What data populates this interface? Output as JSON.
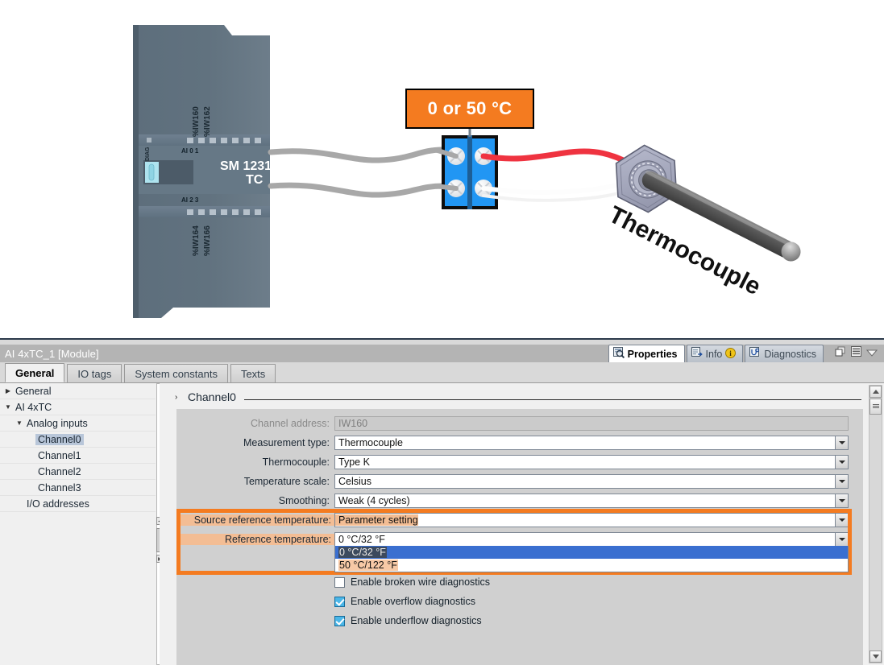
{
  "diagram": {
    "callout_text": "0 or 50 °C",
    "module": {
      "name": "SM 1231",
      "subtitle": "TC",
      "diag_label": "DIAG",
      "addr_top_1": "%IW160",
      "addr_top_2": "%IW162",
      "addr_bot_1": "%IW164",
      "addr_bot_2": "%IW166",
      "ai_top": "AI 0  1",
      "ai_bot": "AI 2  3"
    },
    "sensor_label": "Thermocouple"
  },
  "window": {
    "title": "AI 4xTC_1 [Module]",
    "dock_tabs": [
      {
        "label": "Properties",
        "icon": "properties-icon",
        "active": true
      },
      {
        "label": "Info",
        "icon": "info-icon",
        "badge": "i",
        "active": false
      },
      {
        "label": "Diagnostics",
        "icon": "diagnostics-icon",
        "active": false
      }
    ],
    "controls": [
      {
        "name": "restore-icon"
      },
      {
        "name": "list-icon"
      },
      {
        "name": "chevron-down-icon"
      }
    ]
  },
  "tabs": [
    {
      "label": "General",
      "active": true
    },
    {
      "label": "IO tags",
      "active": false
    },
    {
      "label": "System constants",
      "active": false
    },
    {
      "label": "Texts",
      "active": false
    }
  ],
  "tree": [
    {
      "label": "General",
      "indent": 0,
      "arrow": "▶",
      "selected": false
    },
    {
      "label": "AI 4xTC",
      "indent": 0,
      "arrow": "▼",
      "selected": false
    },
    {
      "label": "Analog inputs",
      "indent": 1,
      "arrow": "▼",
      "selected": false
    },
    {
      "label": "Channel0",
      "indent": 2,
      "arrow": "",
      "selected": true
    },
    {
      "label": "Channel1",
      "indent": 2,
      "arrow": "",
      "selected": false
    },
    {
      "label": "Channel2",
      "indent": 2,
      "arrow": "",
      "selected": false
    },
    {
      "label": "Channel3",
      "indent": 2,
      "arrow": "",
      "selected": false
    },
    {
      "label": "I/O addresses",
      "indent": 1,
      "arrow": "",
      "selected": false
    }
  ],
  "section": {
    "title": "Channel0",
    "expander": "›"
  },
  "fields": [
    {
      "label": "Channel address:",
      "value": "IW160",
      "type": "readonly",
      "label_hl": false,
      "value_hl": false
    },
    {
      "label": "Measurement type:",
      "value": "Thermocouple",
      "type": "dropdown",
      "label_hl": false,
      "value_hl": false
    },
    {
      "label": "Thermocouple:",
      "value": "Type K",
      "type": "dropdown",
      "label_hl": false,
      "value_hl": false
    },
    {
      "label": "Temperature scale:",
      "value": "Celsius",
      "type": "dropdown",
      "label_hl": false,
      "value_hl": false
    },
    {
      "label": "Smoothing:",
      "value": "Weak (4 cycles)",
      "type": "dropdown",
      "label_hl": false,
      "value_hl": false
    },
    {
      "label": "Source reference temperature:",
      "value": "Parameter setting",
      "type": "dropdown",
      "label_hl": true,
      "value_hl": true
    },
    {
      "label": "Reference temperature:",
      "value": "0 °C/32 °F",
      "type": "dropdown-open",
      "label_hl": true,
      "value_hl": false
    }
  ],
  "dropdown_options": [
    {
      "label": "0 °C/32 °F",
      "selected": true,
      "highlight": "selected"
    },
    {
      "label": "50 °C/122 °F",
      "selected": false,
      "highlight": "peach"
    }
  ],
  "checkboxes": [
    {
      "label": "Enable broken wire diagnostics",
      "checked": false
    },
    {
      "label": "Enable overflow diagnostics",
      "checked": true
    },
    {
      "label": "Enable underflow diagnostics",
      "checked": true
    }
  ],
  "colors": {
    "accent_orange": "#F47B20",
    "highlight_peach": "#f3bd94",
    "select_blue": "#3a6fd0",
    "tree_select": "#b8c6d9",
    "checkbox_blue": "#4ab6e8"
  }
}
